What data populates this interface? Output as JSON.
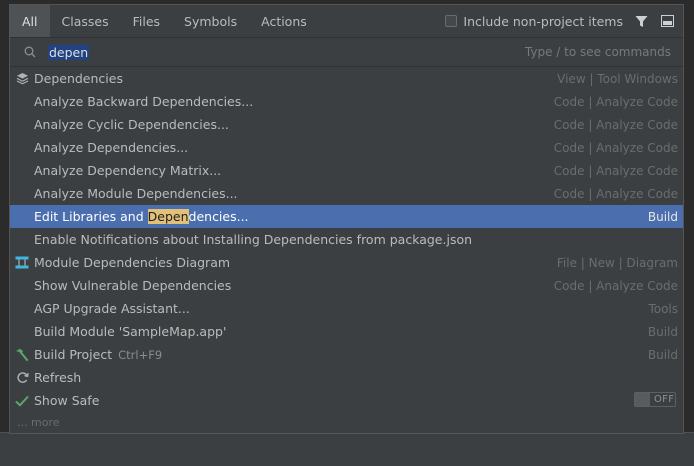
{
  "tabs": [
    "All",
    "Classes",
    "Files",
    "Symbols",
    "Actions"
  ],
  "header": {
    "include_label": "Include non-project items"
  },
  "search": {
    "value": "depen",
    "hint": "Type / to see commands"
  },
  "items": [
    {
      "label": "Dependencies",
      "location": "View | Tool Windows",
      "icon": "layers-icon"
    },
    {
      "label": "Analyze Backward Dependencies...",
      "location": "Code | Analyze Code"
    },
    {
      "label": "Analyze Cyclic Dependencies...",
      "location": "Code | Analyze Code"
    },
    {
      "label": "Analyze Dependencies...",
      "location": "Code | Analyze Code"
    },
    {
      "label": "Analyze Dependency Matrix...",
      "location": "Code | Analyze Code"
    },
    {
      "label": "Analyze Module Dependencies...",
      "location": "Code | Analyze Code"
    },
    {
      "label_pre": "Edit Libraries and ",
      "label_hl": "Depen",
      "label_post": "dencies...",
      "location": "Build",
      "selected": true
    },
    {
      "label": "Enable Notifications about Installing Dependencies from package.json",
      "location": ""
    },
    {
      "label": "Module Dependencies Diagram",
      "location": "File | New | Diagram",
      "icon": "diagram-icon"
    },
    {
      "label": "Show Vulnerable Dependencies",
      "location": "Code | Analyze Code"
    },
    {
      "label": "AGP Upgrade Assistant...",
      "location": "Tools"
    },
    {
      "label": "Build Module 'SampleMap.app'",
      "location": "Build"
    },
    {
      "label": "Build Project",
      "shortcut": "Ctrl+F9",
      "location": "Build",
      "icon": "hammer-icon"
    },
    {
      "label": "Refresh",
      "location": "",
      "icon": "refresh-icon"
    },
    {
      "label": "Show Safe",
      "location": "",
      "icon": "check-icon",
      "toggle": "OFF"
    }
  ],
  "more_label": "... more",
  "colors": {
    "selection": "#4b6eaf",
    "highlight": "#e2c078",
    "background": "#3c3f41"
  }
}
